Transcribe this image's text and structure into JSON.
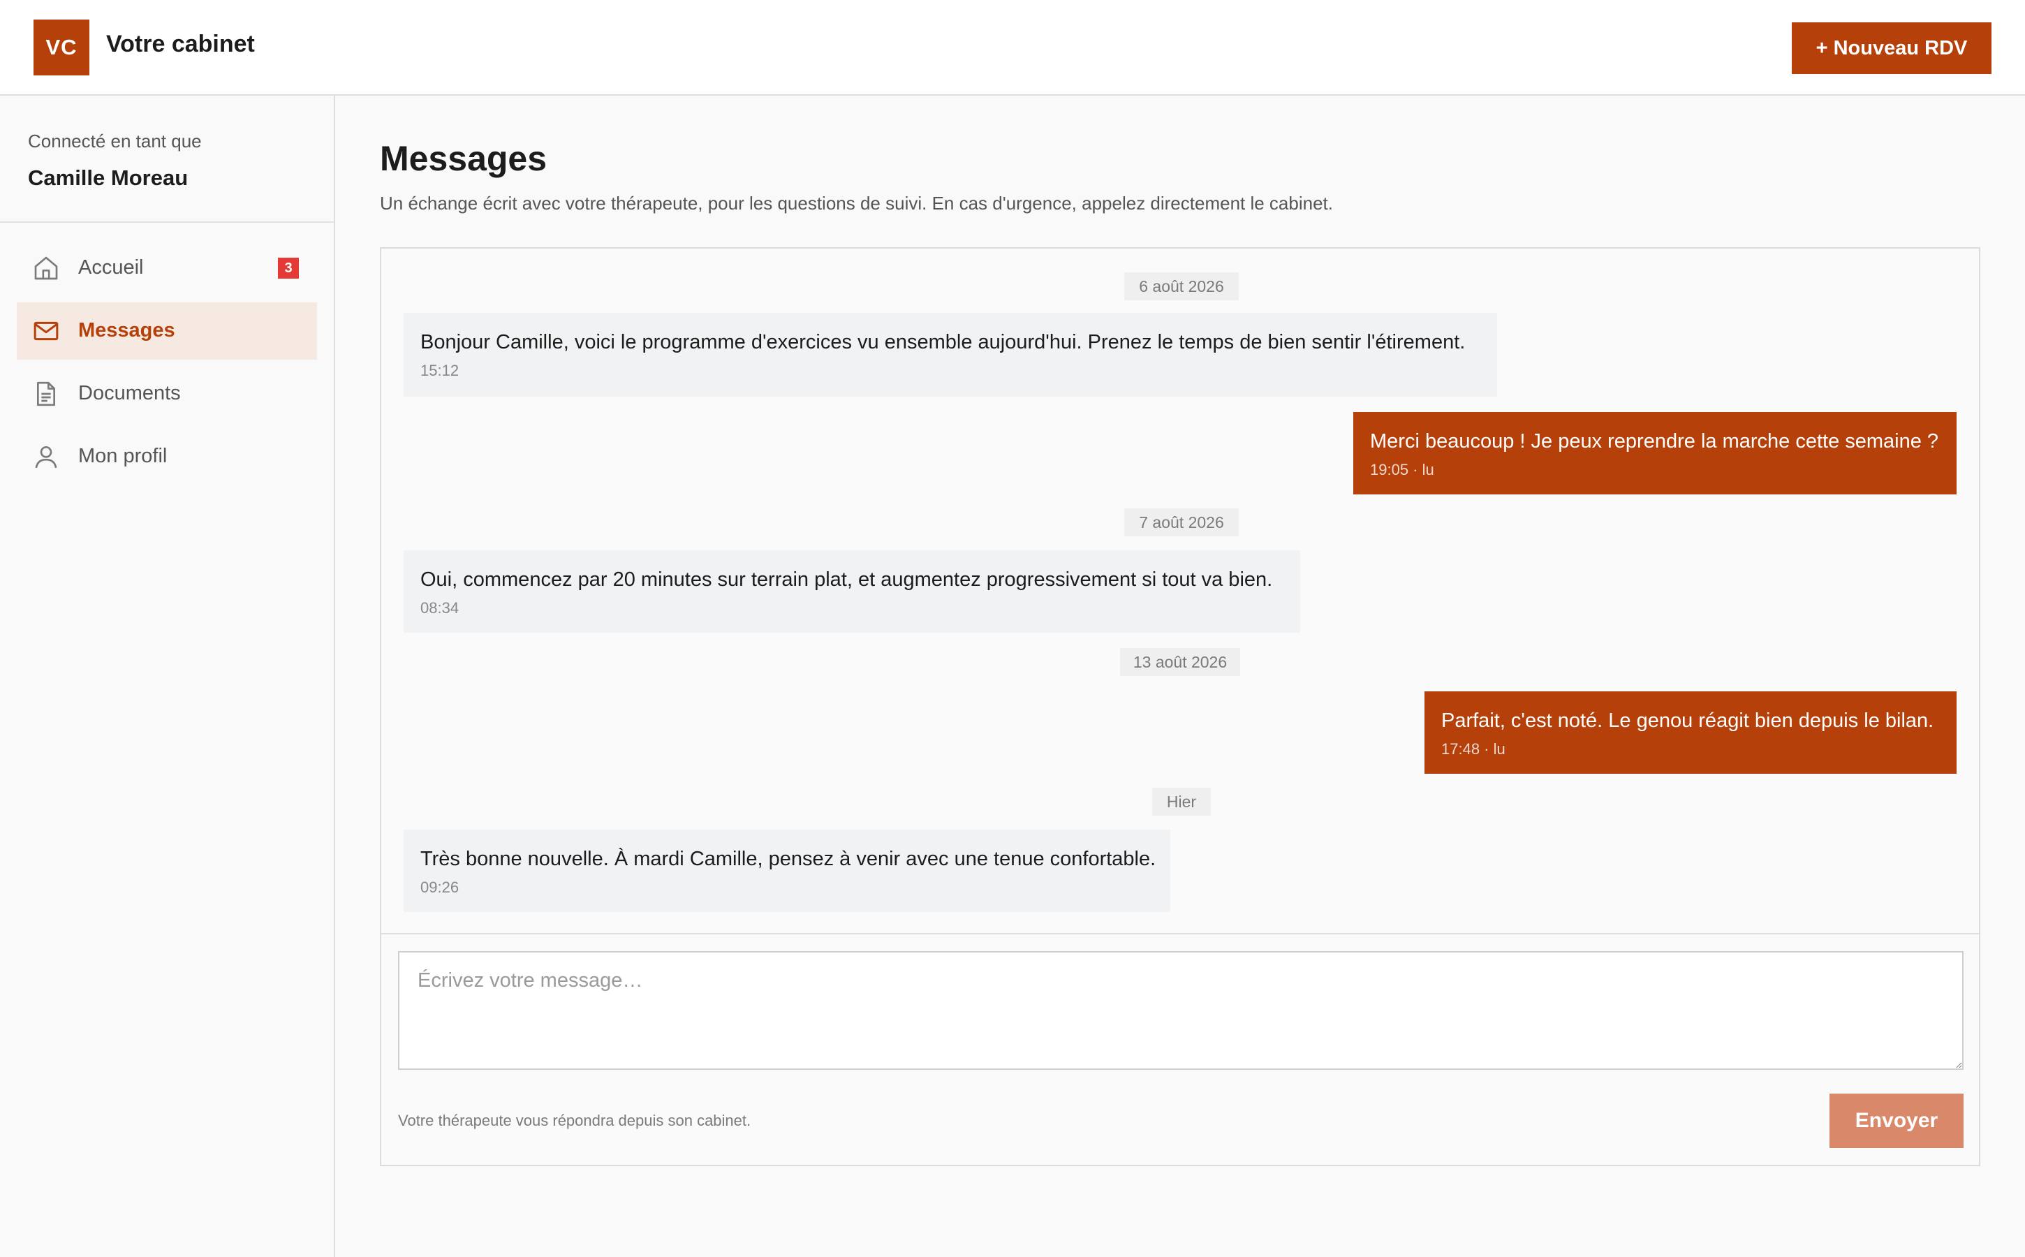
{
  "header": {
    "logo_text": "VC",
    "brand": "Votre cabinet",
    "new_button": "+ Nouveau RDV"
  },
  "sidebar": {
    "connected_label": "Connecté en tant que",
    "user_name": "Camille Moreau",
    "items": [
      {
        "label": "Accueil",
        "icon": "home-icon",
        "badge": "3"
      },
      {
        "label": "Messages",
        "icon": "mail-icon",
        "active": true
      },
      {
        "label": "Documents",
        "icon": "document-icon"
      },
      {
        "label": "Mon profil",
        "icon": "user-icon"
      }
    ]
  },
  "main": {
    "title": "Messages",
    "subtitle": "Un échange écrit avec votre thérapeute, pour les questions de suivi. En cas d'urgence, appelez directement le cabinet.",
    "thread": {
      "dates": [
        "6 août 2026",
        "7 août 2026",
        "13 août 2026",
        "Hier"
      ],
      "messages": [
        {
          "direction": "in",
          "text": "Bonjour Camille, voici le programme d'exercices vu ensemble aujourd'hui. Prenez le temps de bien sentir l'étirement.",
          "time": "15:12"
        },
        {
          "direction": "out",
          "text": "Merci beaucoup ! Je peux reprendre la marche cette semaine ?",
          "time": "19:05 · lu"
        },
        {
          "direction": "in",
          "text": "Oui, commencez par 20 minutes sur terrain plat, et augmentez progressivement si tout va bien.",
          "time": "08:34"
        },
        {
          "direction": "out",
          "text": "Parfait, c'est noté. Le genou réagit bien depuis le bilan.",
          "time": "17:48 · lu"
        },
        {
          "direction": "in",
          "text": "Très bonne nouvelle. À mardi Camille, pensez à venir avec une tenue confortable.",
          "time": "09:26"
        }
      ]
    },
    "composer": {
      "placeholder": "Écrivez votre message…",
      "value": "",
      "hint": "Votre thérapeute vous répondra depuis son cabinet.",
      "send_label": "Envoyer"
    }
  },
  "colors": {
    "accent": "#b5400a",
    "accent_light": "#f6e9e1",
    "send_disabled": "#d9896a",
    "badge": "#e53935",
    "incoming_bubble": "#f1f2f4"
  }
}
